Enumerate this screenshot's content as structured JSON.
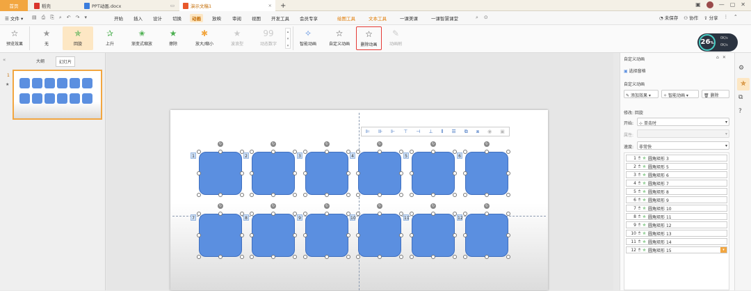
{
  "tabs": {
    "home": "首页",
    "t1": "稻壳",
    "t2": "PPT动画.docx",
    "t3": "演示文稿1",
    "add": "+"
  },
  "menubar": {
    "file": "文件",
    "items": [
      "开始",
      "插入",
      "设计",
      "切换",
      "动画",
      "放映",
      "审阅",
      "视图",
      "开发工具",
      "会员专享"
    ],
    "ctx1": "绘图工具",
    "ctx2": "文本工具",
    "extra1": "一课美课",
    "extra2": "一课智慧课堂",
    "unsaved": "未保存",
    "collab": "协作",
    "share": "分享"
  },
  "ribbon": {
    "preview": "预览效果",
    "effects": [
      "无",
      "回旋",
      "上升",
      "渐变式缩放",
      "擦除",
      "放大/缩小",
      "波浪型",
      "动态数字"
    ],
    "smart": "智能动画",
    "custom": "自定义动画",
    "delete": "删除动画",
    "painter": "动画刷"
  },
  "gauge": {
    "value": "26",
    "unit": "%",
    "up": "0K/s",
    "down": "0K/s"
  },
  "leftpane": {
    "outline": "大纲",
    "slides": "幻灯片",
    "slide_num": "1"
  },
  "slide": {
    "labels_top": [
      "1",
      "2",
      "3",
      "4",
      "5",
      "6"
    ],
    "labels_bottom": [
      "7",
      "8",
      "9",
      "10",
      "11",
      "12"
    ]
  },
  "rightpane": {
    "title": "自定义动画",
    "select_pane": "选择窗格",
    "custom_label": "自定义动画",
    "add_effect": "添加效果",
    "smart_anim": "智能动画",
    "delete": "删除",
    "modify": "修改: 回旋",
    "start_label": "开始:",
    "start_value": "单击时",
    "prop_label": "属性:",
    "speed_label": "速度:",
    "speed_value": "非常快",
    "list": [
      {
        "n": "1",
        "name": "圆角矩形 3"
      },
      {
        "n": "2",
        "name": "圆角矩形 5"
      },
      {
        "n": "3",
        "name": "圆角矩形 6"
      },
      {
        "n": "4",
        "name": "圆角矩形 7"
      },
      {
        "n": "5",
        "name": "圆角矩形 8"
      },
      {
        "n": "6",
        "name": "圆角矩形 9"
      },
      {
        "n": "7",
        "name": "圆角矩形 10"
      },
      {
        "n": "8",
        "name": "圆角矩形 11"
      },
      {
        "n": "9",
        "name": "圆角矩形 12"
      },
      {
        "n": "10",
        "name": "圆角矩形 13"
      },
      {
        "n": "11",
        "name": "圆角矩形 14"
      },
      {
        "n": "12",
        "name": "圆角矩形 15"
      }
    ]
  },
  "colors": {
    "accent": "#f2a640",
    "shape": "#5b8fe0",
    "highlight": "#e53935"
  }
}
